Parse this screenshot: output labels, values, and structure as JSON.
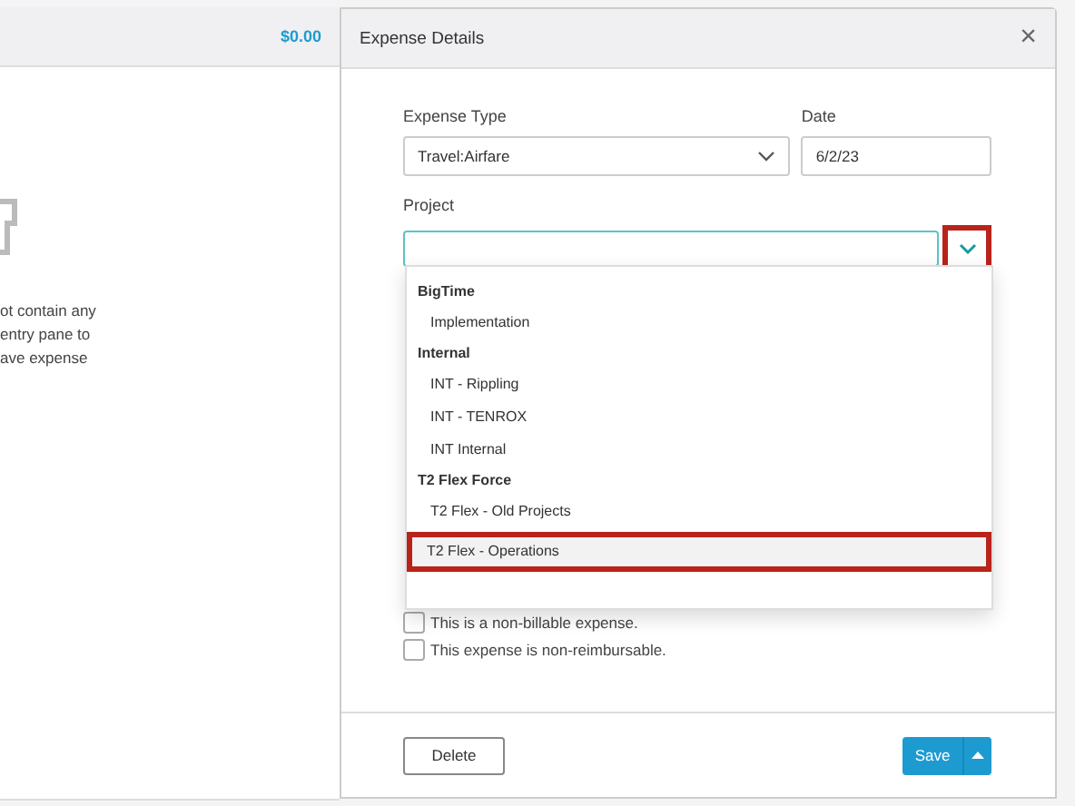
{
  "left_pane": {
    "total": "$0.00",
    "message_lines": [
      "ot contain any",
      "entry pane to",
      "ave expense"
    ]
  },
  "panel": {
    "title": "Expense Details",
    "close": "×"
  },
  "form": {
    "expense_type": {
      "label": "Expense Type",
      "value": "Travel:Airfare"
    },
    "date": {
      "label": "Date",
      "value": "6/2/23"
    },
    "project": {
      "label": "Project",
      "expanded": true
    }
  },
  "project_options": [
    {
      "group": "BigTime",
      "items": [
        {
          "label": "Implementation",
          "selected": false
        }
      ]
    },
    {
      "group": "Internal",
      "items": [
        {
          "label": "INT - Rippling",
          "selected": false
        },
        {
          "label": "INT - TENROX",
          "selected": false
        },
        {
          "label": "INT Internal",
          "selected": false
        }
      ]
    },
    {
      "group": "T2 Flex Force",
      "items": [
        {
          "label": "T2 Flex - Old Projects",
          "selected": false
        },
        {
          "label": "T2 Flex - Operations",
          "selected": true
        }
      ]
    }
  ],
  "checkboxes": [
    {
      "label": "This is a non-billable expense.",
      "checked": false
    },
    {
      "label": "This expense is non-reimbursable.",
      "checked": false
    }
  ],
  "footer": {
    "delete": "Delete",
    "save": "Save"
  }
}
